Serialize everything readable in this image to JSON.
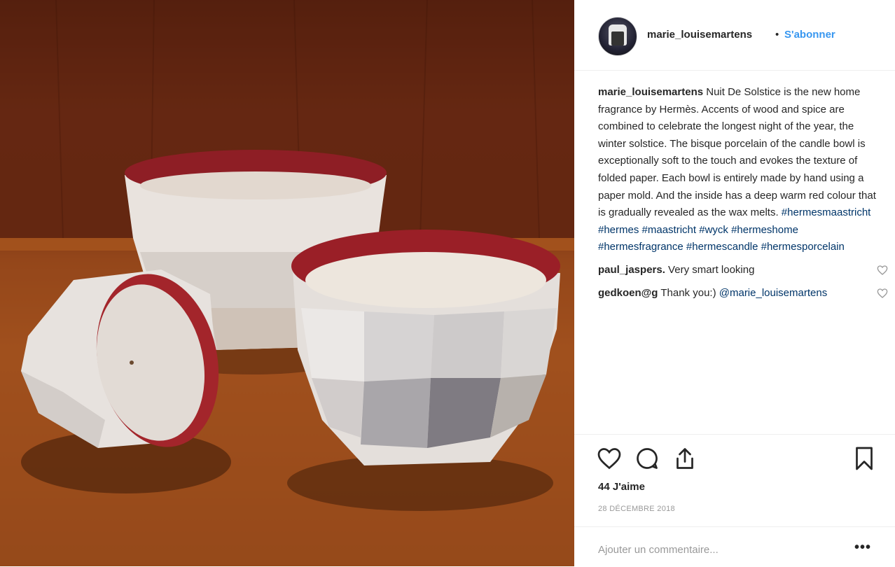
{
  "post": {
    "username": "marie_louisemartens",
    "separator": "•",
    "follow_label": "S'abonner",
    "caption_user": "marie_louisemartens",
    "caption_text": " Nuit De Solstice is the new home fragrance by Hermès. Accents of wood and spice are combined to celebrate the longest night of the year, the winter solstice. The bisque porcelain of the candle bowl is exceptionally soft to the touch and evokes the texture of folded paper. Each bowl is entirely made by hand using a paper mold. And the inside has a deep warm red colour that is gradually revealed as the wax melts. ",
    "hashtags": "#hermesmaastricht #hermes #maastricht #wyck #hermeshome #hermesfragrance #hermescandle #hermesporcelain"
  },
  "comments": [
    {
      "user": "paul_jaspers.",
      "text": " Very smart looking"
    },
    {
      "user": "gedkoen@g",
      "text": " Thank you:) ",
      "mention": "@marie_louisemartens"
    }
  ],
  "actions": {
    "likes": "44 J'aime",
    "date": "28 DÉCEMBRE 2018",
    "add_comment_placeholder": "Ajouter un commentaire...",
    "more_label": "•••"
  },
  "icons": [
    "heart-icon",
    "comment-icon",
    "share-icon",
    "bookmark-icon",
    "small-heart-icon"
  ]
}
